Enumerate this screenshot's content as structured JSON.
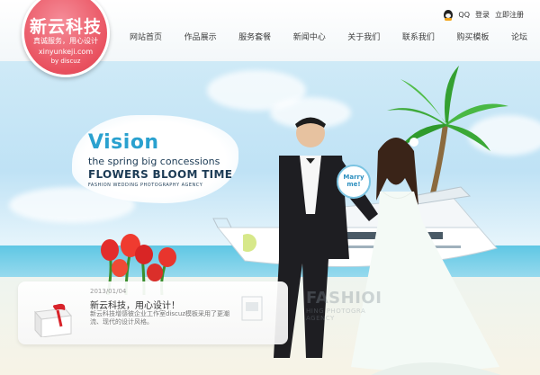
{
  "logo": {
    "title": "新云科技",
    "slogan": "真诚服务，用心设计",
    "domain": "xinyunkeji.com",
    "by": "by discuz",
    "color": "#e9515f"
  },
  "topbar": {
    "qq": "QQ",
    "login": "登录",
    "register": "立即注册"
  },
  "nav": {
    "items": [
      "网站首页",
      "作品展示",
      "服务套餐",
      "新闻中心",
      "关于我们",
      "联系我们",
      "购买模板",
      "论坛"
    ]
  },
  "banner": {
    "vision": {
      "title": "Vision",
      "line1": "the spring big concessions",
      "line2": "FLOWERS BLOOM TIME",
      "line3": "FASHION WEDDING PHOTOGRAPHY AGENCY"
    },
    "bubble": [
      "Marry",
      "me!"
    ],
    "fashion": {
      "title": "FASHIOI",
      "sub1": "AGENCY",
      "sub2": "HING PHOTOGRA"
    },
    "accent": "#2aa1cf"
  },
  "news": {
    "date": "2013/01/04",
    "title": "新云科技，用心设计！",
    "desc": "新云科技增感彼企业工作室discuz模板采用了更潮流、现代的设计风格。"
  }
}
